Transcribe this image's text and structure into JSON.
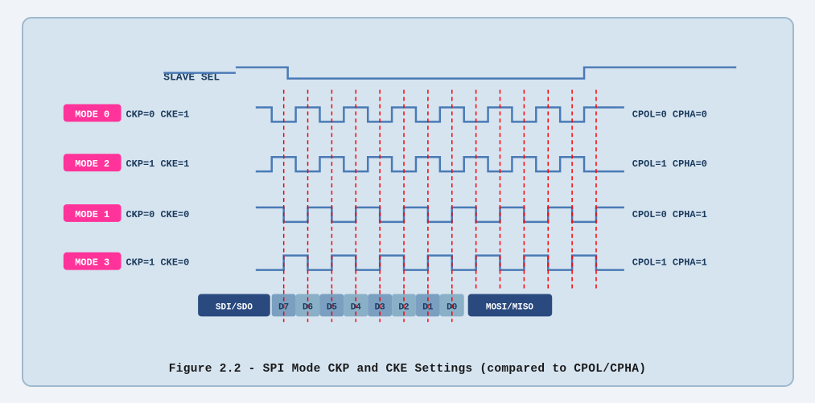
{
  "caption": "Figure 2.2 - SPI Mode CKP and CKE Settings (compared to CPOL/CPHA)",
  "diagram": {
    "slave_sel_label": "SLAVE SEL",
    "modes": [
      {
        "badge": "MODE 0",
        "params": "CKP=0  CKE=1",
        "right": "CPOL=0  CPHA=0"
      },
      {
        "badge": "MODE 2",
        "params": "CKP=1  CKE=1",
        "right": "CPOL=1  CPHA=0"
      },
      {
        "badge": "MODE 1",
        "params": "CKP=0  CKE=0",
        "right": "CPOL=0  CPHA=1"
      },
      {
        "badge": "MODE 3",
        "params": "CKP=1  CKE=0",
        "right": "CPOL=1  CPHA=1"
      }
    ],
    "data_bits": [
      "SDI/SDO",
      "D7",
      "D6",
      "D5",
      "D4",
      "D3",
      "D2",
      "D1",
      "D0",
      "MOSI/MISO"
    ]
  }
}
